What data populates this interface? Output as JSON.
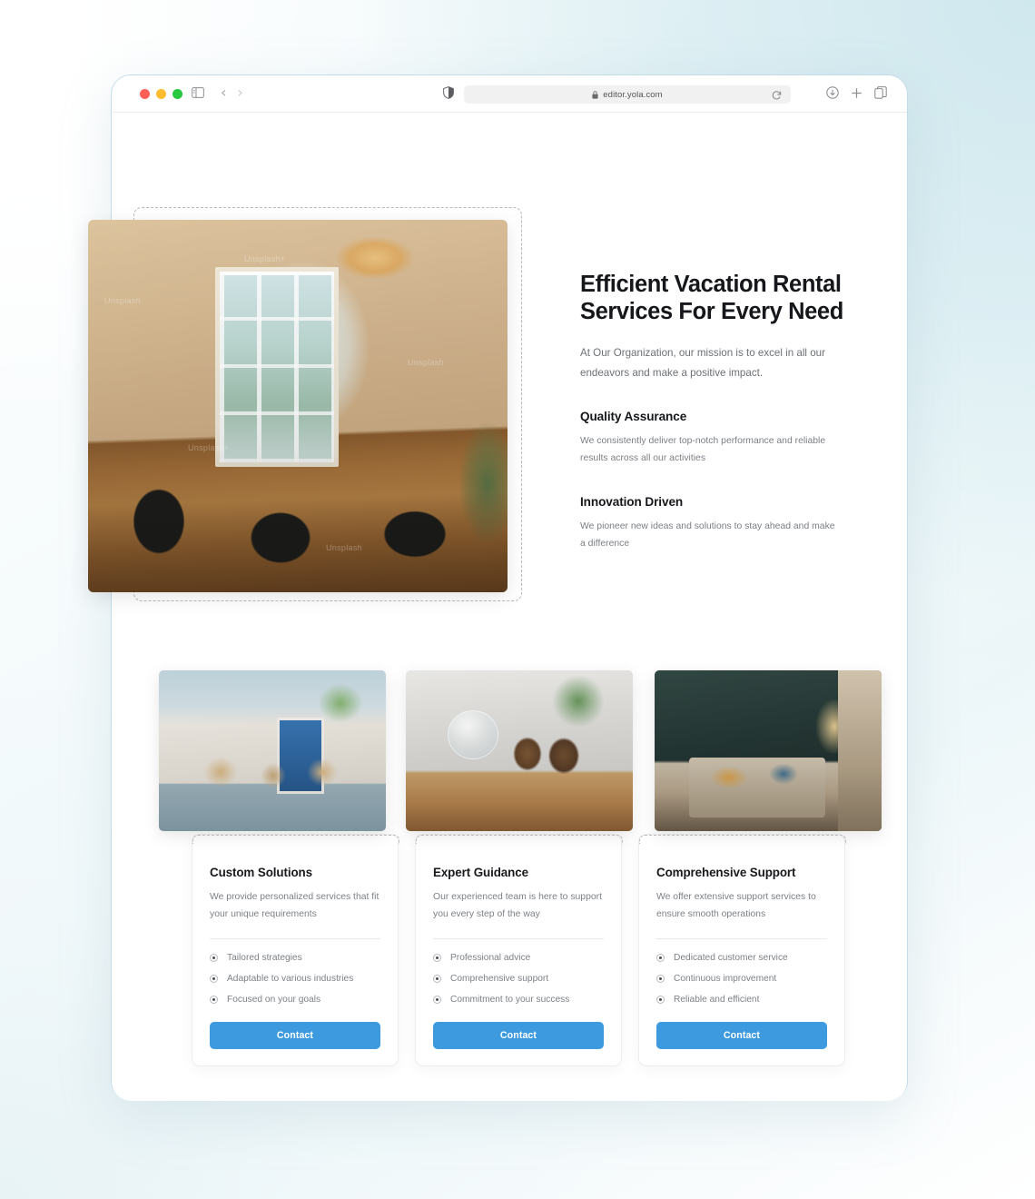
{
  "browser": {
    "traffic_lights": [
      "close",
      "minimize",
      "maximize"
    ],
    "sidebar_icon": "sidebar-icon",
    "back_label": "‹",
    "forward_label": "›",
    "shield_icon": "shield-icon",
    "lock_icon": "lock-icon",
    "url": "editor.yola.com",
    "reload_icon": "reload-icon",
    "download_icon": "download-icon",
    "new_tab_icon": "plus-icon",
    "tabs_icon": "copy-tabs-icon"
  },
  "hero": {
    "title": "Efficient Vacation Rental Services For Every Need",
    "subtitle": "At Our Organization, our mission is to excel in all our endeavors and make a positive impact.",
    "features": [
      {
        "title": "Quality Assurance",
        "body": "We consistently deliver top-notch performance and reliable results across all our activities"
      },
      {
        "title": "Innovation Driven",
        "body": "We pioneer new ideas and solutions to stay ahead and make a difference"
      }
    ],
    "image_alt": "dining-room-photo",
    "watermarks": [
      "Unsplash",
      "Unsplash+",
      "Unsplash",
      "Unsplash+",
      "Unsplash"
    ]
  },
  "cards": [
    {
      "image_alt": "patio-chairs-photo",
      "title": "Custom Solutions",
      "description": "We provide personalized services that fit your unique requirements",
      "items": [
        "Tailored strategies",
        "Adaptable to various industries",
        "Focused on your goals"
      ],
      "button": "Contact"
    },
    {
      "image_alt": "pinecone-table-photo",
      "title": "Expert Guidance",
      "description": "Our experienced team is here to support you every step of the way",
      "items": [
        "Professional advice",
        "Comprehensive support",
        "Commitment to your success"
      ],
      "button": "Contact"
    },
    {
      "image_alt": "bedroom-interior-photo",
      "title": "Comprehensive Support",
      "description": "We offer extensive support services to ensure smooth operations",
      "items": [
        "Dedicated customer service",
        "Continuous improvement",
        "Reliable and efficient"
      ],
      "button": "Contact"
    }
  ],
  "colors": {
    "accent": "#3d9ade",
    "heading": "#15171a",
    "body_text": "#7b7f84",
    "window_border": "#c3dcea",
    "selection_dash": "#bdbdbd",
    "bg_top_right": "#cfe8ee"
  }
}
